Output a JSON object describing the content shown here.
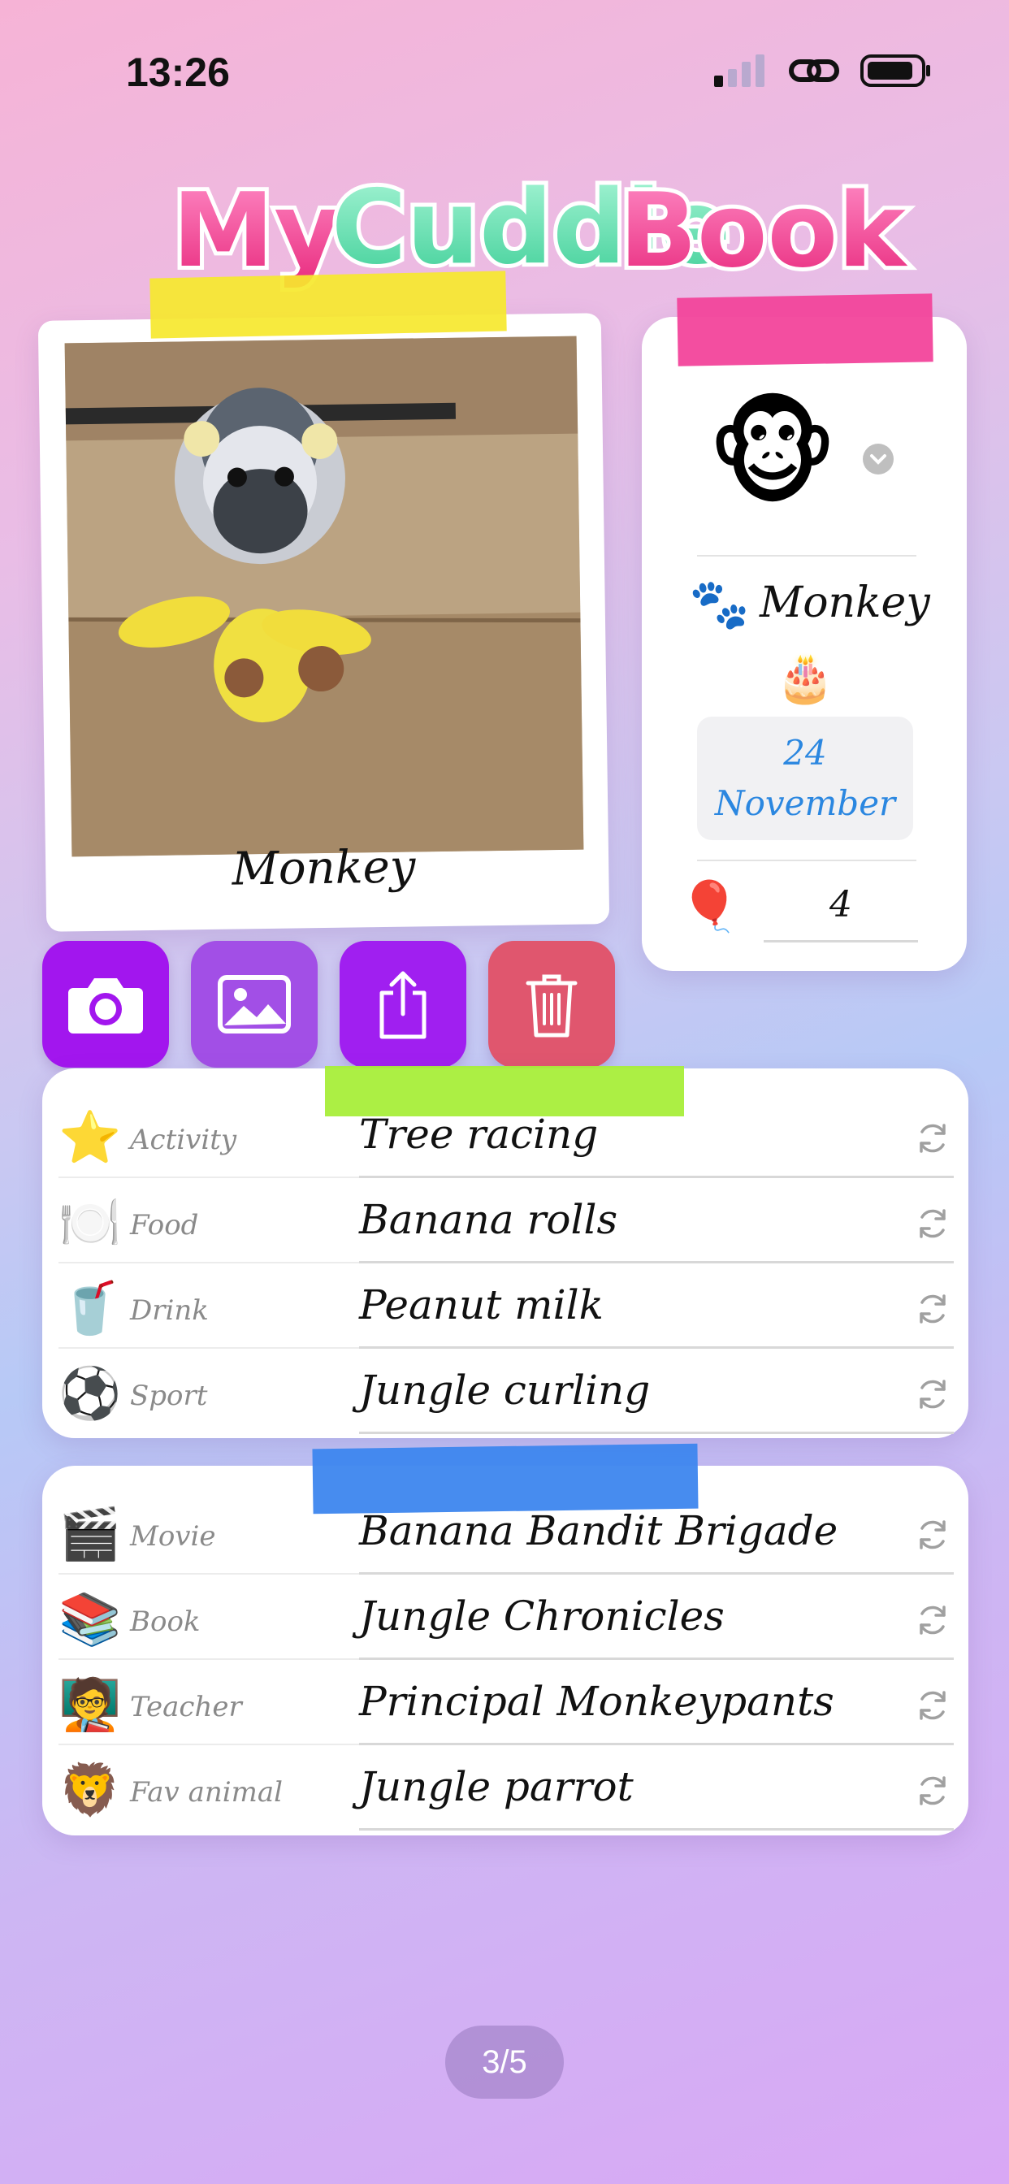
{
  "status_bar": {
    "time": "13:26"
  },
  "app": {
    "title": "MyCuddleBook"
  },
  "profile": {
    "photo_caption": "Monkey",
    "avatar_emoji": "🐵",
    "species_icon": "🐾",
    "species": "Monkey",
    "birthday_icon": "🎂",
    "birthday_day": "24",
    "birthday_month": "November",
    "age_icon": "🎈",
    "age": "4"
  },
  "actions": [
    {
      "name": "camera-button",
      "icon": "camera-icon",
      "color": "#a216ee"
    },
    {
      "name": "gallery-button",
      "icon": "image-icon",
      "color": "#a24fe6"
    },
    {
      "name": "share-button",
      "icon": "share-icon",
      "color": "#a01ff0"
    },
    {
      "name": "delete-button",
      "icon": "trash-icon",
      "color": "#e0566e"
    }
  ],
  "favorites_1": [
    {
      "emoji": "⭐",
      "label": "Activity",
      "value": "Tree racing"
    },
    {
      "emoji": "🍽️",
      "label": "Food",
      "value": "Banana rolls"
    },
    {
      "emoji": "🥤",
      "label": "Drink",
      "value": "Peanut milk"
    },
    {
      "emoji": "⚽",
      "label": "Sport",
      "value": "Jungle curling"
    }
  ],
  "favorites_2": [
    {
      "emoji": "🎬",
      "label": "Movie",
      "value": "Banana Bandit Brigade"
    },
    {
      "emoji": "📚",
      "label": "Book",
      "value": "Jungle Chronicles"
    },
    {
      "emoji": "🧑‍🏫",
      "label": "Teacher",
      "value": "Principal Monkeypants"
    },
    {
      "emoji": "🦁",
      "label": "Fav animal",
      "value": "Jungle parrot"
    }
  ],
  "pager": {
    "text": "3/5"
  },
  "colors": {
    "tape_yellow": "#f6e82e",
    "tape_pink": "#f2449b",
    "tape_green": "#a8ee3a",
    "tape_blue": "#3d86ee",
    "date_text": "#2b87e0"
  }
}
